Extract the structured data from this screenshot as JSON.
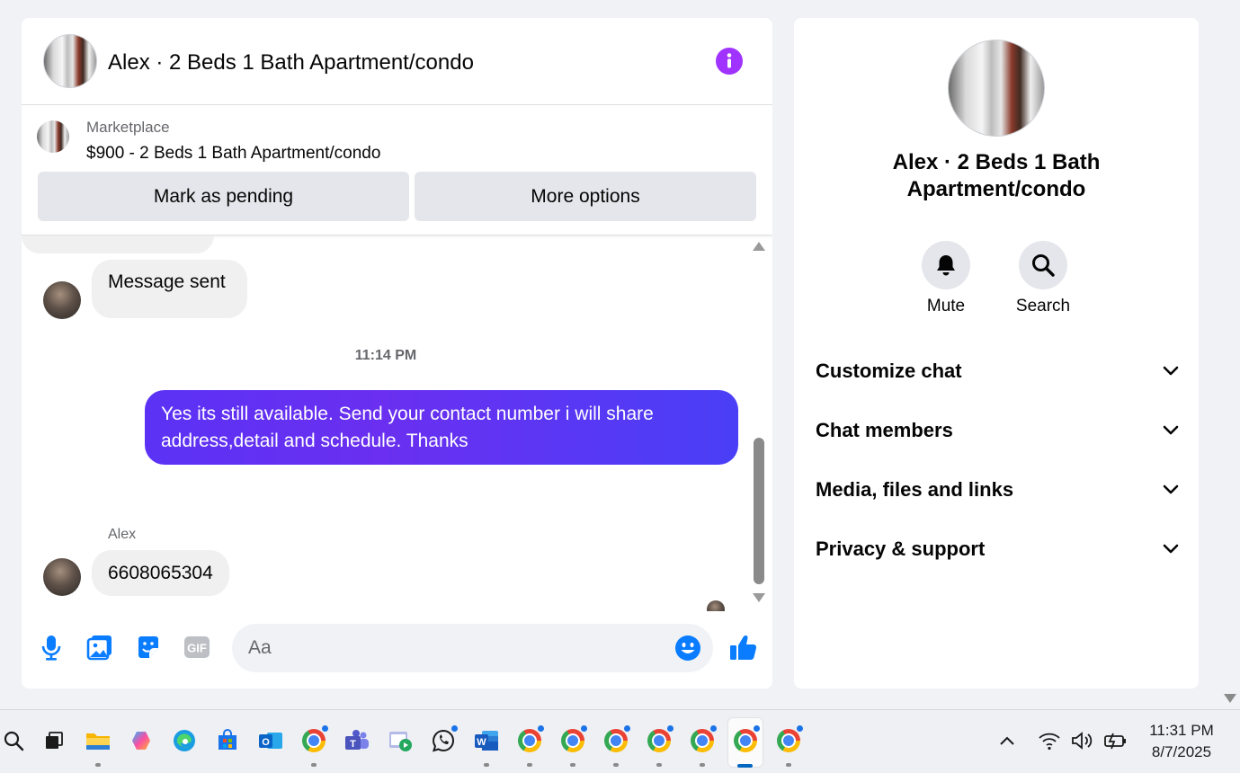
{
  "header": {
    "title": "Alex · 2 Beds 1 Bath Apartment/condo",
    "info_icon": "info-icon"
  },
  "marketplace": {
    "label": "Marketplace",
    "listing_title": "$900 - 2 Beds 1 Bath Apartment/condo",
    "mark_pending_label": "Mark as pending",
    "more_options_label": "More options"
  },
  "messages": {
    "msg1_text": "Message sent",
    "timestamp": "11:14 PM",
    "outgoing_text": "Yes its still available. Send your contact number i will share address,detail and schedule. Thanks",
    "sender_name": "Alex",
    "msg2_text": "6608065304"
  },
  "composer": {
    "placeholder": "Aa",
    "icons": [
      "microphone-icon",
      "photo-icon",
      "sticker-icon",
      "gif-icon",
      "emoji-icon",
      "thumbs-up-icon"
    ],
    "gif_label": "GIF"
  },
  "info_panel": {
    "title": "Alex · 2 Beds 1 Bath Apartment/condo",
    "mute_label": "Mute",
    "search_label": "Search",
    "sections": [
      "Customize chat",
      "Chat members",
      "Media, files and links",
      "Privacy & support"
    ]
  },
  "colors": {
    "accent_purple": "#a033ff",
    "outgoing_bubble": "#5b32f5",
    "messenger_blue": "#0a7cff"
  },
  "taskbar": {
    "time": "11:31 PM",
    "date": "8/7/2025"
  }
}
